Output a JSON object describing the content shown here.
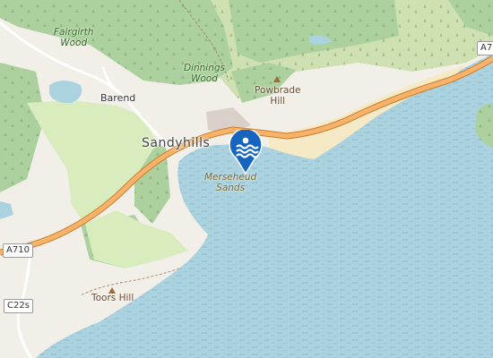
{
  "map": {
    "colors": {
      "land": "#f2efe9",
      "water": "#aad3df",
      "forest": "#add19e",
      "scrub": "#c8d7ab",
      "park": "#c8facc",
      "sand": "#f5e9c6",
      "road": "#f9b26a",
      "marker": "#1565c0"
    },
    "labels": {
      "fairgirth_wood": "Fairgirth\nWood",
      "dinnings_wood": "Dinnings\nWood",
      "barend": "Barend",
      "sandyhills": "Sandyhills",
      "powbrade_hill": "Powbrade\nHill",
      "merseheud_sands": "Merseheud\nSands",
      "toors_hill": "Toors Hill"
    },
    "roads": {
      "a710_west": "A710",
      "a710_east": "A71",
      "c22s": "C22s"
    },
    "marker": {
      "icon": "swimming-icon",
      "label": "Merseheud Sands"
    }
  }
}
